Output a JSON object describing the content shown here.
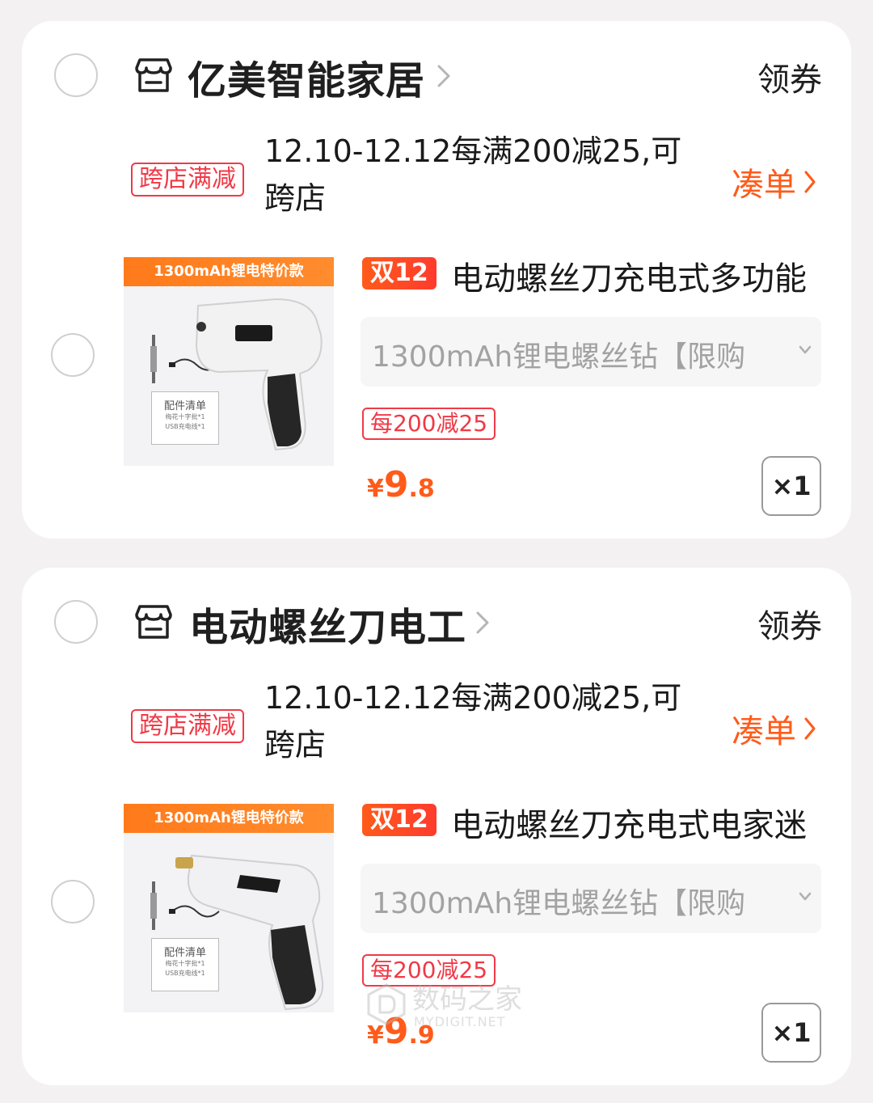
{
  "colors": {
    "accent": "#ff5b1a",
    "promo_red": "#f03a47",
    "card_bg": "#ffffff",
    "page_bg": "#f4f1f3"
  },
  "stores": [
    {
      "name": "亿美智能家居",
      "coupon": "领券",
      "promo": {
        "badge": "跨店满减",
        "text": "12.10-12.12每满200减25,可跨店",
        "action": "凑单"
      },
      "item": {
        "image_banner": "1300mAh锂电特价款",
        "image_box_title": "配件清单",
        "image_box_line1": "梅花十字批*1",
        "image_box_line2": "USB充电线*1",
        "tag": "双12",
        "title": "电动螺丝刀充电式多功能",
        "sku": "1300mAh锂电螺丝钻【限购",
        "deal": "每200减25",
        "price_symbol": "¥",
        "price_int": "9",
        "price_dec": ".8",
        "quantity": "×1"
      }
    },
    {
      "name": "电动螺丝刀电工",
      "coupon": "领券",
      "promo": {
        "badge": "跨店满减",
        "text": "12.10-12.12每满200减25,可跨店",
        "action": "凑单"
      },
      "item": {
        "image_banner": "1300mAh锂电特价款",
        "image_box_title": "配件清单",
        "image_box_line1": "梅花十字批*1",
        "image_box_line2": "USB充电线*1",
        "tag": "双12",
        "title": "电动螺丝刀充电式电家迷",
        "sku": "1300mAh锂电螺丝钻【限购",
        "deal": "每200减25",
        "price_symbol": "¥",
        "price_int": "9",
        "price_dec": ".9",
        "quantity": "×1"
      }
    }
  ],
  "watermark": {
    "main": "数码之家",
    "sub": "MYDIGIT.NET"
  }
}
